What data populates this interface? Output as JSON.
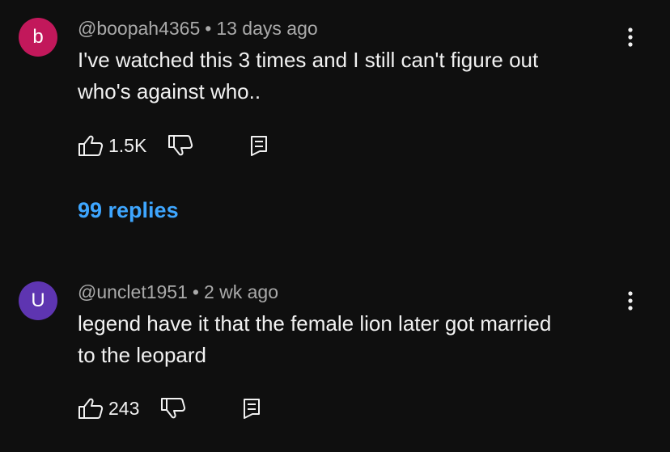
{
  "comments": [
    {
      "avatar_letter": "b",
      "avatar_color": "#c2185b",
      "handle": "@boopah4365",
      "separator": "•",
      "time": "13 days ago",
      "text_line1": "I've watched this 3 times and I still can't figure out",
      "text_line2": "who's against who..",
      "likes": "1.5K",
      "replies_label": "99 replies"
    },
    {
      "avatar_letter": "U",
      "avatar_color": "#5e35b1",
      "handle": "@unclet1951",
      "separator": "•",
      "time": "2 wk ago",
      "text_line1": "legend have it that the female lion later got married",
      "text_line2": "to the leopard",
      "likes": "243"
    }
  ],
  "icons": {
    "like": "thumbs-up-icon",
    "dislike": "thumbs-down-icon",
    "reply": "reply-icon",
    "menu": "more-vert-icon"
  },
  "colors": {
    "background": "#0f0f0f",
    "link": "#3ea6ff",
    "secondary_text": "#aaaaaa"
  }
}
